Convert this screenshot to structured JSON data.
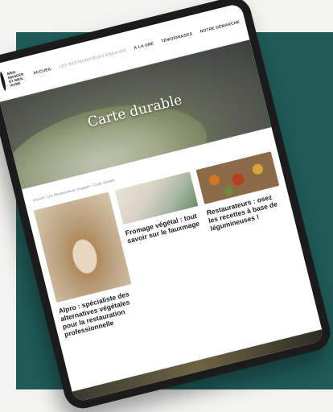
{
  "header": {
    "logo_text": "BIEN MANGER ET BIEN VIVRE",
    "nav": [
      "ACCUEIL",
      "LES RESTAURATEURS ENGAGÉS",
      "À LA UNE",
      "TÉMOIGNAGES",
      "NOTRE DÉMARCHE"
    ]
  },
  "hero": {
    "title": "Carte durable"
  },
  "breadcrumb": "Accueil › Les Restaurateurs engagés › Carte durable",
  "articles": [
    {
      "title": "Alpro : spécialiste des alternatives végétales pour la restauration professionnelle"
    },
    {
      "title": "Fromage végétal : tout savoir sur le fauxmage"
    },
    {
      "title": "Restaurateurs : osez les recettes à base de légumineuses !"
    }
  ],
  "colors": {
    "background_panel": "#1f5b57",
    "tablet_bezel": "#1b1b1b"
  }
}
